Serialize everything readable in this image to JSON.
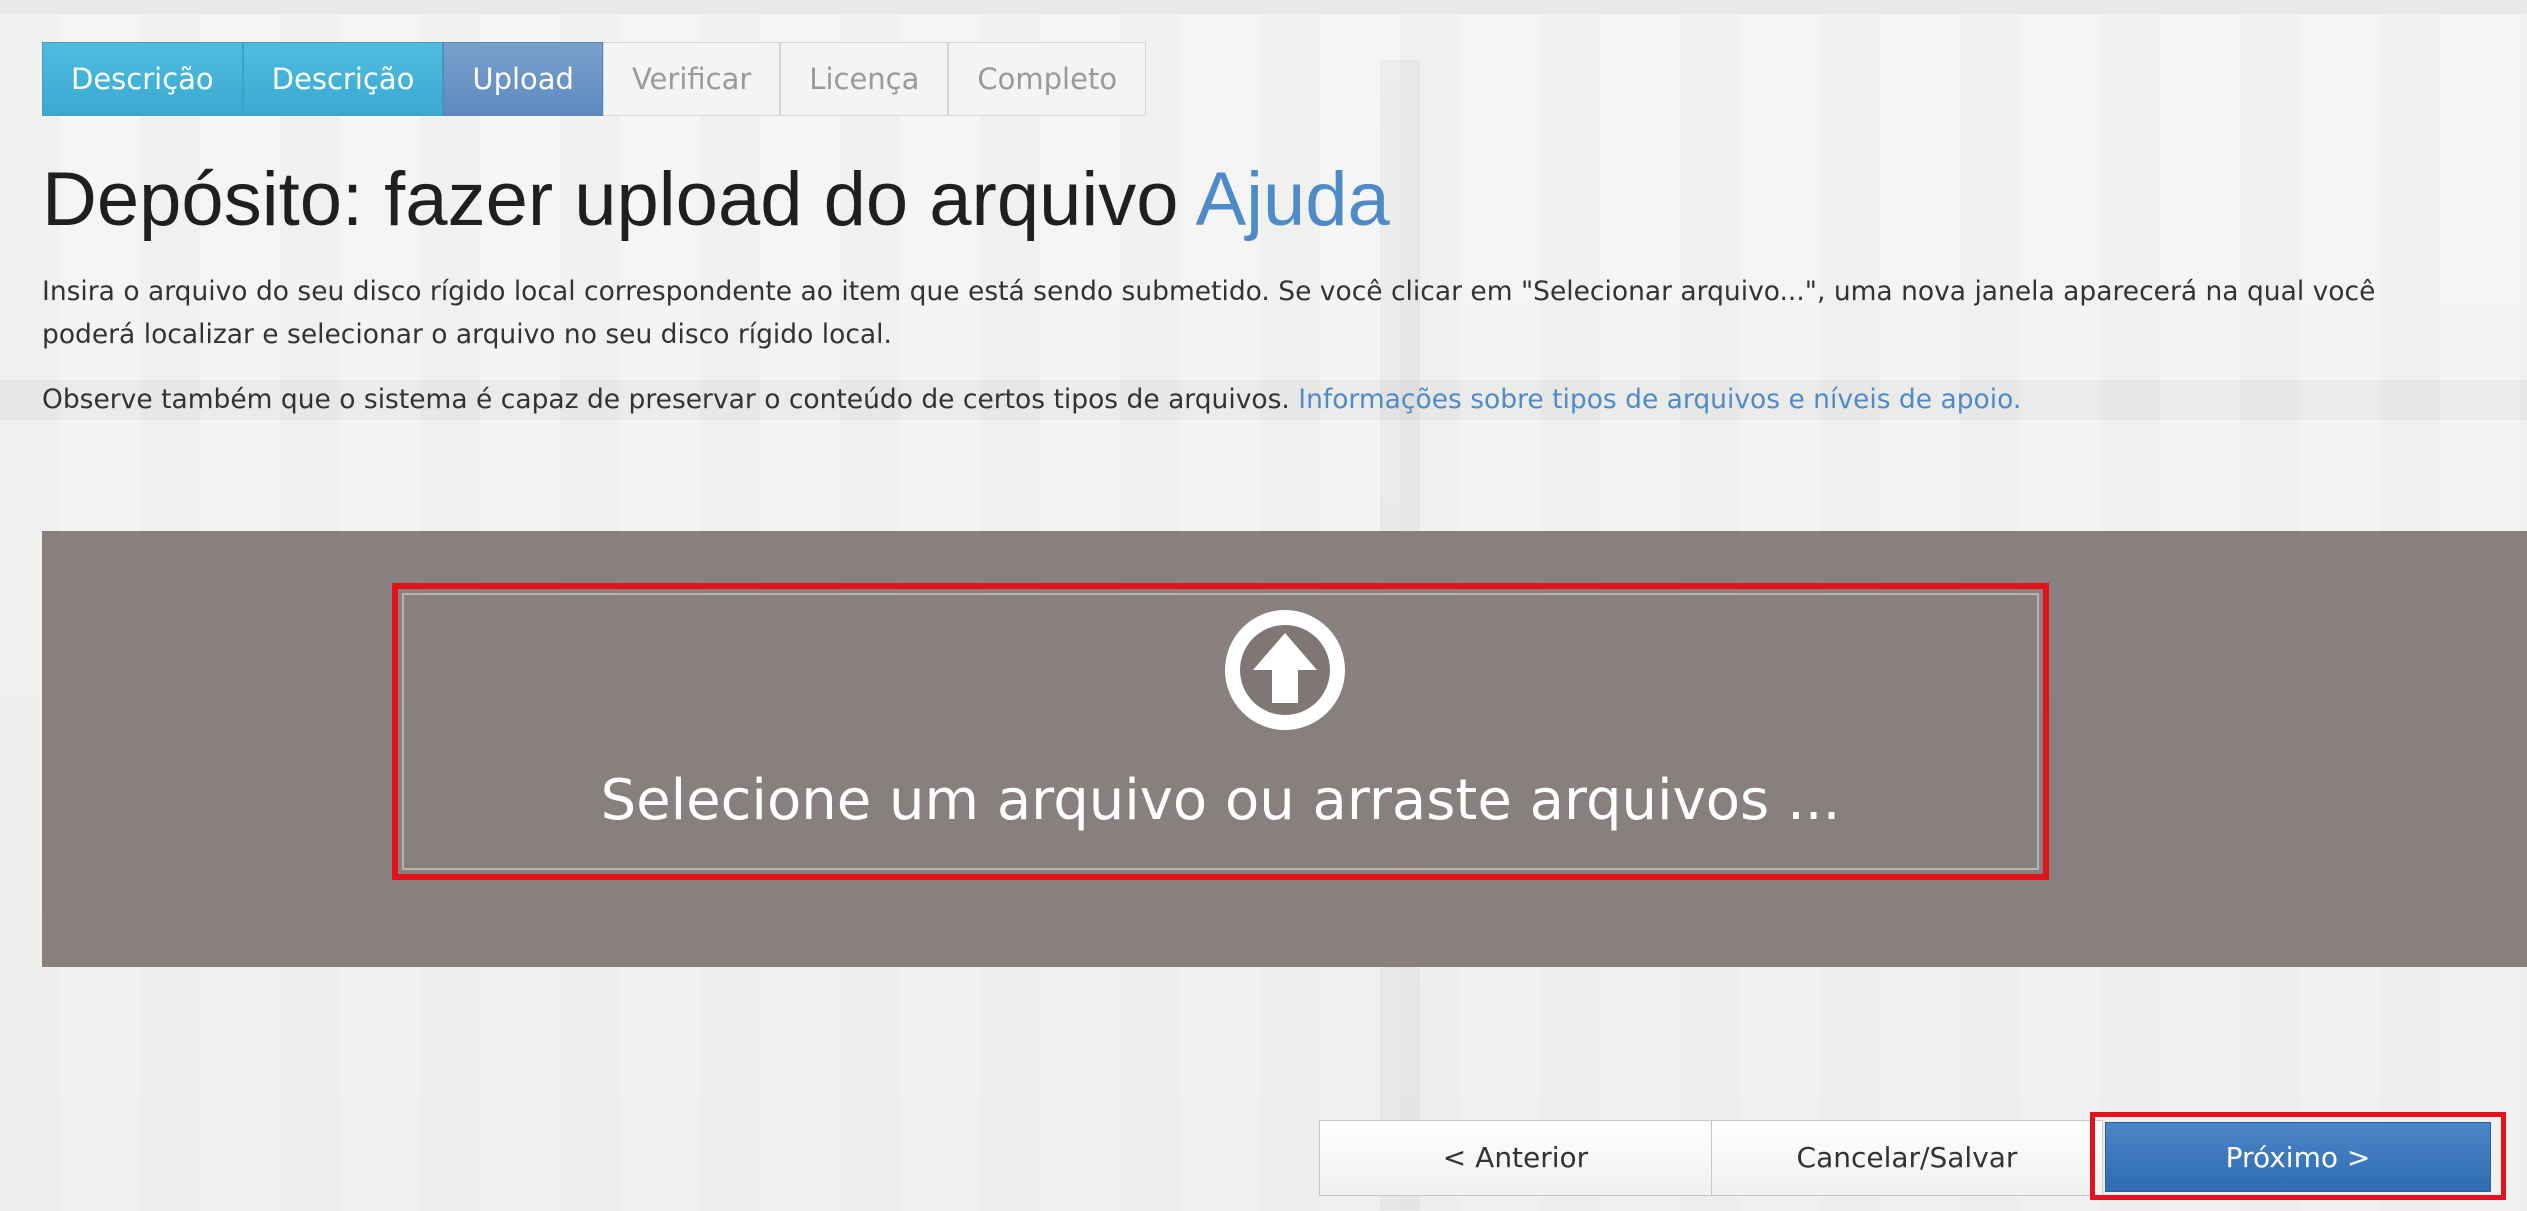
{
  "steps": [
    {
      "label": "Descrição",
      "state": "done"
    },
    {
      "label": "Descrição",
      "state": "done"
    },
    {
      "label": "Upload",
      "state": "current"
    },
    {
      "label": "Verificar",
      "state": "todo"
    },
    {
      "label": "Licença",
      "state": "todo"
    },
    {
      "label": "Completo",
      "state": "todo"
    }
  ],
  "heading": {
    "title": "Depósito: fazer upload do arquivo",
    "help_link": "Ajuda"
  },
  "instructions": {
    "line1": "Insira o arquivo do seu disco rígido local correspondente ao item que está sendo submetido. Se você clicar em \"Selecionar arquivo...\", uma nova janela aparecerá na qual você",
    "line2": "poderá localizar e selecionar o arquivo no seu disco rígido local.",
    "preserve_text": "Observe também que o sistema é capaz de preservar o conteúdo de certos tipos de arquivos.",
    "preserve_link": "Informações sobre tipos de arquivos e níveis de apoio."
  },
  "dropzone": {
    "icon": "upload-arrow-icon",
    "text": "Selecione um arquivo ou arraste arquivos ..."
  },
  "buttons": {
    "previous": "< Anterior",
    "cancel_save": "Cancelar/Salvar",
    "next": "Próximo >"
  },
  "colors": {
    "step_done": "#3aa9d2",
    "step_current": "#6a92c3",
    "link": "#4f8bc9",
    "highlight": "#e3121d",
    "panel": "#807676",
    "next_button": "#3a78bc"
  }
}
